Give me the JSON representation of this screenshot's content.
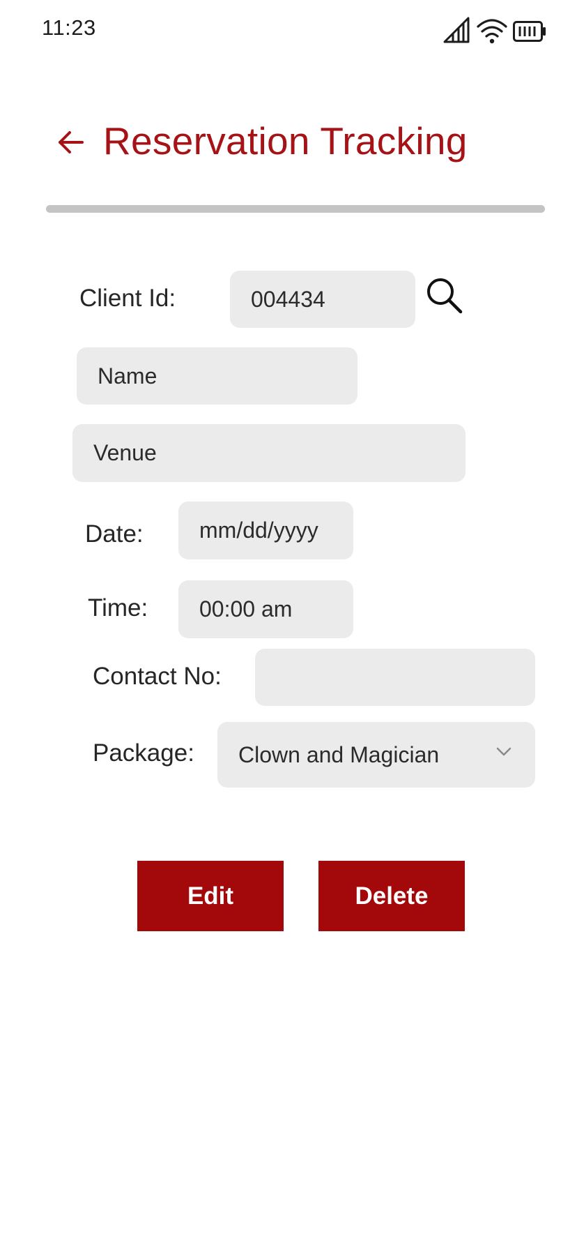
{
  "status_bar": {
    "time": "11:23",
    "icons": [
      "signal-icon",
      "wifi-icon",
      "battery-icon"
    ]
  },
  "header": {
    "back_icon": "arrow-left-icon",
    "title": "Reservation Tracking"
  },
  "form": {
    "client_id_label": "Client Id:",
    "client_id_value": "004434",
    "search_icon": "search-icon",
    "name_placeholder": "Name",
    "venue_placeholder": "Venue",
    "date_label": "Date:",
    "date_placeholder": "mm/dd/yyyy",
    "time_label": "Time:",
    "time_placeholder": "00:00 am",
    "contact_label": "Contact No:",
    "contact_value": "",
    "package_label": "Package:",
    "package_selected": "Clown and Magician"
  },
  "actions": {
    "edit_label": "Edit",
    "delete_label": "Delete"
  },
  "colors": {
    "accent": "#a51316",
    "button": "#a3080a",
    "field_bg": "#ebebeb",
    "divider": "#c4c4c4"
  }
}
